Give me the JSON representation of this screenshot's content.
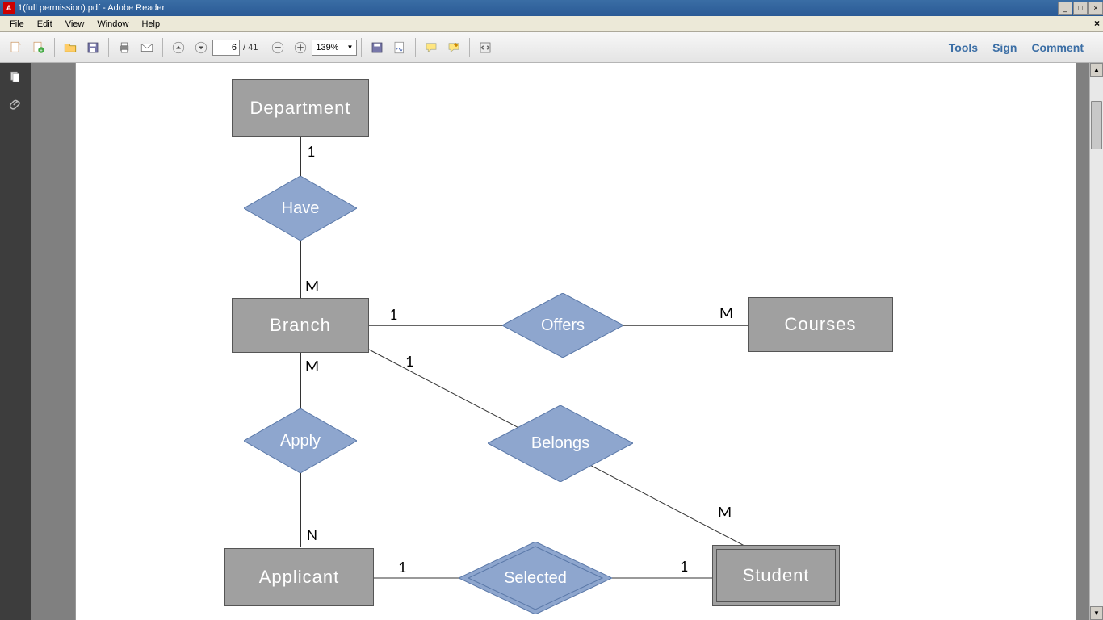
{
  "window": {
    "title": "1(full permission).pdf - Adobe Reader"
  },
  "menu": {
    "items": [
      "File",
      "Edit",
      "View",
      "Window",
      "Help"
    ]
  },
  "toolbar": {
    "page_current": "6",
    "page_total": "/ 41",
    "zoom": "139%",
    "links": {
      "tools": "Tools",
      "sign": "Sign",
      "comment": "Comment"
    }
  },
  "diagram": {
    "entities": {
      "department": "Department",
      "branch": "Branch",
      "courses": "Courses",
      "applicant": "Applicant",
      "student": "Student"
    },
    "relations": {
      "have": "Have",
      "offers": "Offers",
      "apply": "Apply",
      "belongs": "Belongs",
      "selected": "Selected"
    },
    "card": {
      "dept_have": "1",
      "have_branch": "M",
      "branch_offers": "1",
      "offers_courses": "M",
      "branch_apply": "M",
      "apply_applicant": "N",
      "branch_belongs": "1",
      "belongs_student": "M",
      "applicant_selected": "1",
      "selected_student": "1"
    }
  }
}
